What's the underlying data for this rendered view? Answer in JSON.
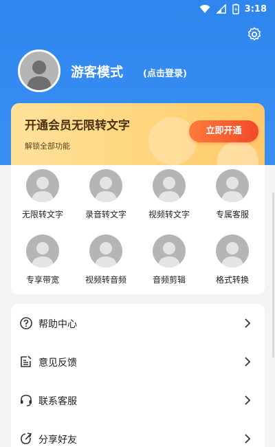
{
  "status_bar": {
    "time": "3:18",
    "icons": [
      "wifi-icon",
      "signal-icon",
      "battery-icon"
    ]
  },
  "header": {
    "username": "游客模式",
    "login_link": "(点击登录)",
    "settings_icon": "gear-icon",
    "avatar_icon": "default-avatar-icon"
  },
  "vip": {
    "title": "开通会员无限转文字",
    "subtitle": "解锁全部功能",
    "button": "立即开通"
  },
  "features": [
    {
      "label": "无限转文字",
      "icon": "placeholder-avatar-icon"
    },
    {
      "label": "录音转文字",
      "icon": "placeholder-avatar-icon"
    },
    {
      "label": "视频转文字",
      "icon": "placeholder-avatar-icon"
    },
    {
      "label": "专属客服",
      "icon": "placeholder-avatar-icon"
    },
    {
      "label": "专享带宽",
      "icon": "placeholder-avatar-icon"
    },
    {
      "label": "视频转音频",
      "icon": "placeholder-avatar-icon"
    },
    {
      "label": "音频剪辑",
      "icon": "placeholder-avatar-icon"
    },
    {
      "label": "格式转换",
      "icon": "placeholder-avatar-icon"
    }
  ],
  "menu": [
    {
      "label": "帮助中心",
      "icon": "help-circle-icon"
    },
    {
      "label": "意见反馈",
      "icon": "feedback-icon"
    },
    {
      "label": "联系客服",
      "icon": "headset-icon"
    },
    {
      "label": "分享好友",
      "icon": "share-icon"
    }
  ],
  "colors": {
    "header_blue": "#2e86ee",
    "vip_gold": "#ffd47a",
    "vip_button": "#f24a2a",
    "placeholder_gray": "#b5b5b5"
  }
}
